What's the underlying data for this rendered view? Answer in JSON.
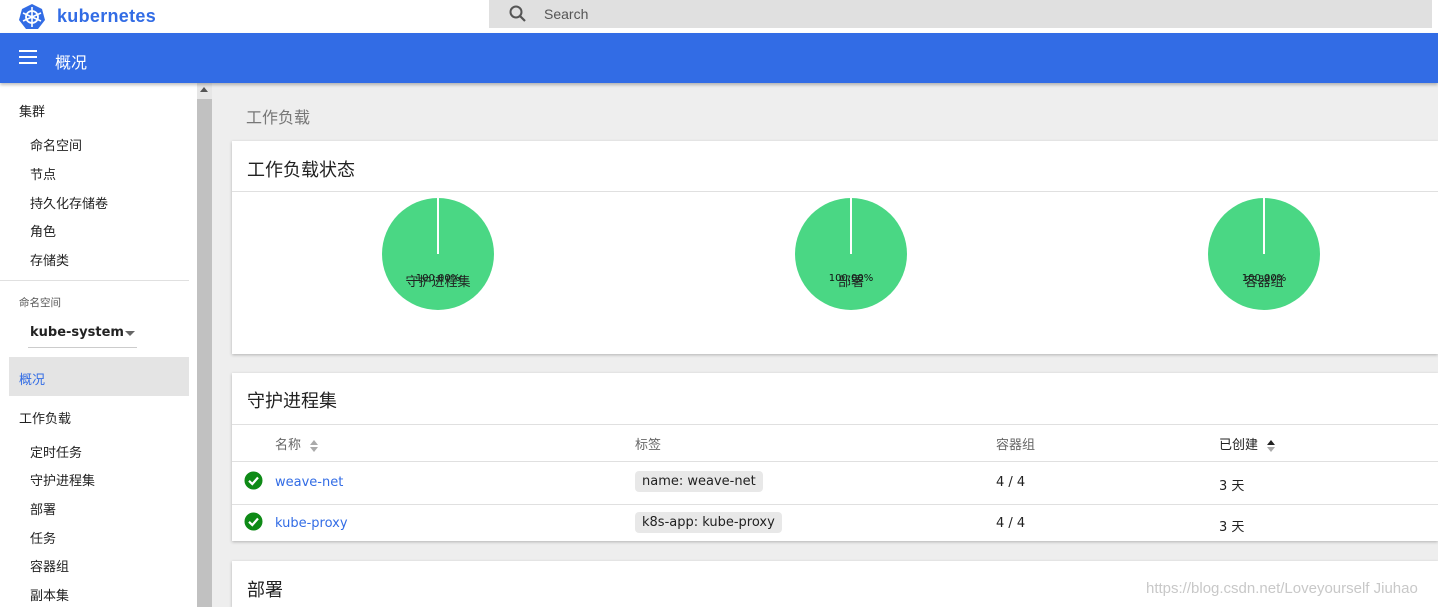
{
  "app": {
    "name": "kubernetes"
  },
  "search": {
    "placeholder": "Search"
  },
  "header": {
    "title": "概况"
  },
  "sidebar": {
    "cluster_heading": "集群",
    "cluster_items": [
      "命名空间",
      "节点",
      "持久化存储卷",
      "角色",
      "存储类"
    ],
    "namespace_label": "命名空间",
    "namespace_value": "kube-system",
    "active_item": "概况",
    "workloads_heading": "工作负载",
    "workload_items": [
      "定时任务",
      "守护进程集",
      "部署",
      "任务",
      "容器组",
      "副本集"
    ]
  },
  "breadcrumb": "工作负载",
  "workload_status": {
    "title": "工作负载状态",
    "charts": [
      {
        "label": "守护进程集",
        "percent": "100.00%",
        "value": 100,
        "color": "#4ad784"
      },
      {
        "label": "部署",
        "percent": "100.00%",
        "value": 100,
        "color": "#4ad784"
      },
      {
        "label": "容器组",
        "percent": "100.00%",
        "value": 100,
        "color": "#4ad784"
      }
    ]
  },
  "daemonsets": {
    "title": "守护进程集",
    "columns": {
      "name": "名称",
      "labels": "标签",
      "pods": "容器组",
      "created": "已创建"
    },
    "rows": [
      {
        "name": "weave-net",
        "label": "name: weave-net",
        "pods": "4 / 4",
        "created": "3 天",
        "status": "ok"
      },
      {
        "name": "kube-proxy",
        "label": "k8s-app: kube-proxy",
        "pods": "4 / 4",
        "created": "3 天",
        "status": "ok"
      }
    ]
  },
  "deployments": {
    "title": "部署"
  },
  "watermark": "https://blog.csdn.net/Loveyourself Jiuhao",
  "colors": {
    "brand": "#326ce5",
    "ok": "#0e8a16",
    "pie": "#4ad784"
  }
}
